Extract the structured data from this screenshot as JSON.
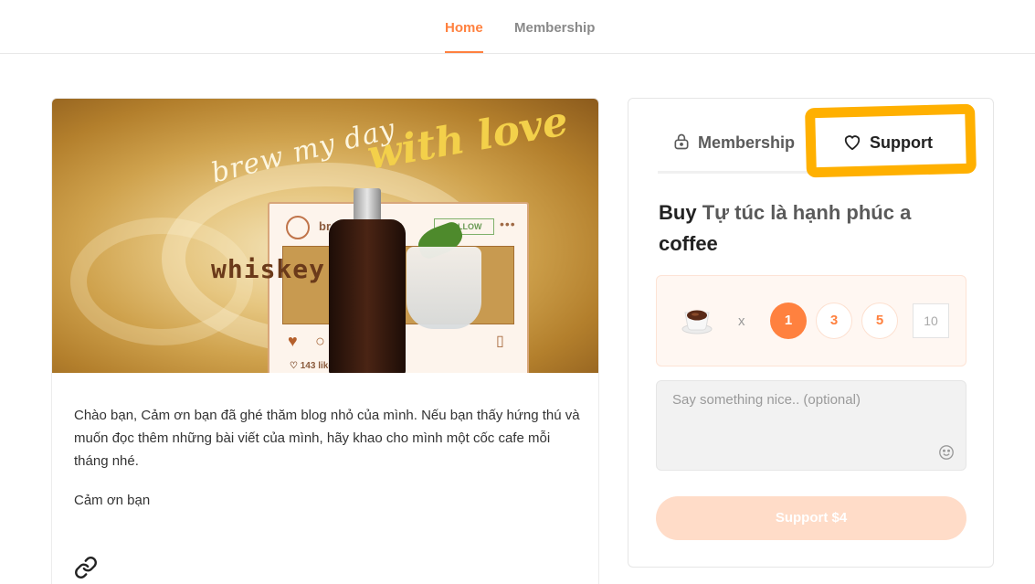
{
  "nav": {
    "tabs": [
      {
        "label": "Home",
        "active": true
      },
      {
        "label": "Membership",
        "active": false
      }
    ]
  },
  "post": {
    "hero_image": {
      "script_text_1": "brew my day",
      "script_text_2": "with love",
      "overlay_word": "whiskey",
      "post_username": "br",
      "follow_label": "FOLLOW",
      "likes": "143 likes"
    },
    "body": "Chào bạn, Cảm ơn bạn đã ghé thăm blog nhỏ của mình. Nếu bạn thấy hứng thú và muốn đọc thêm những bài viết của mình, hãy khao cho mình một cốc cafe mỗi tháng nhé.",
    "thanks": "Cảm ơn bạn",
    "link_icon": "link-icon"
  },
  "panel": {
    "tabs": [
      {
        "label": "Membership",
        "icon": "lock-icon"
      },
      {
        "label": "Support",
        "icon": "heart-icon",
        "active": true
      }
    ],
    "highlight_color": "#ffb000",
    "buy": {
      "prefix": "Buy",
      "creator": "Tự túc là hạnh phúc a",
      "item": "coffee"
    },
    "quantity": {
      "icon": "coffee-cup-icon",
      "times": "x",
      "options": [
        "1",
        "3",
        "5"
      ],
      "selected": "1",
      "custom_placeholder": "10"
    },
    "message": {
      "placeholder": "Say something nice.. (optional)",
      "emoji_icon": "smiley-icon"
    },
    "submit_label": "Support $4"
  },
  "colors": {
    "accent": "#ff813f",
    "button_disabled": "#ffdcc8",
    "qty_bg": "#fff7f2"
  }
}
